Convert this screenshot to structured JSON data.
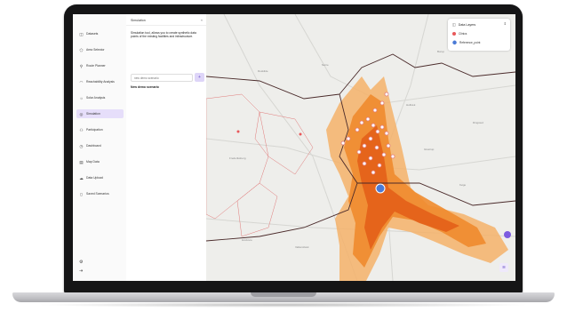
{
  "colors": {
    "accent": "#7c5ce0",
    "active_bg": "#e6defa",
    "heat_light": "#f5b16a",
    "heat_mid": "#f08b2e",
    "heat_dark": "#e4621a",
    "boundary": "#4a2a2a",
    "reference_pin": "#4a7ad6"
  },
  "sidebar": {
    "items": [
      {
        "label": "Datasets",
        "icon": "database-icon"
      },
      {
        "label": "Area Selector",
        "icon": "polygon-icon"
      },
      {
        "label": "Route Planner",
        "icon": "route-icon"
      },
      {
        "label": "Reachability Analysis",
        "icon": "wifi-icon"
      },
      {
        "label": "Solar Analysis",
        "icon": "solar-icon"
      },
      {
        "label": "Simulation",
        "icon": "simulation-icon",
        "active": true
      },
      {
        "label": "Participation",
        "icon": "people-icon"
      },
      {
        "label": "Dashboard",
        "icon": "dashboard-icon"
      },
      {
        "label": "Map Data",
        "icon": "map-icon"
      },
      {
        "label": "Data Upload",
        "icon": "cloud-upload-icon"
      },
      {
        "label": "Saved Scenarios",
        "icon": "bookmark-icon"
      }
    ],
    "bottom_icons": [
      "settings-icon",
      "logout-icon"
    ]
  },
  "panel": {
    "title": "Simulation",
    "collapse_icon": "«",
    "description": "Simulation tool, allows you to create synthetic data points of the existing facilities and infrastructure.",
    "input_placeholder": "new demo scenario",
    "add_icon": "+",
    "new_scenario_label": "New demo scenario"
  },
  "map": {
    "labels": [
      "Roskilde",
      "Nørre",
      "Holbæk",
      "Frederiksberg",
      "Køge",
      "Hvidovre",
      "Vallensbæk",
      "Glostrup",
      "Borup",
      "Ringsted"
    ],
    "layers": {
      "title": "Data Layers",
      "chevron": "⇕",
      "items": [
        {
          "label": "Clinics",
          "color": "#e8585a"
        },
        {
          "label": "Reference_point",
          "color": "#4a7ad6"
        }
      ]
    },
    "stack_icon": "≋"
  }
}
